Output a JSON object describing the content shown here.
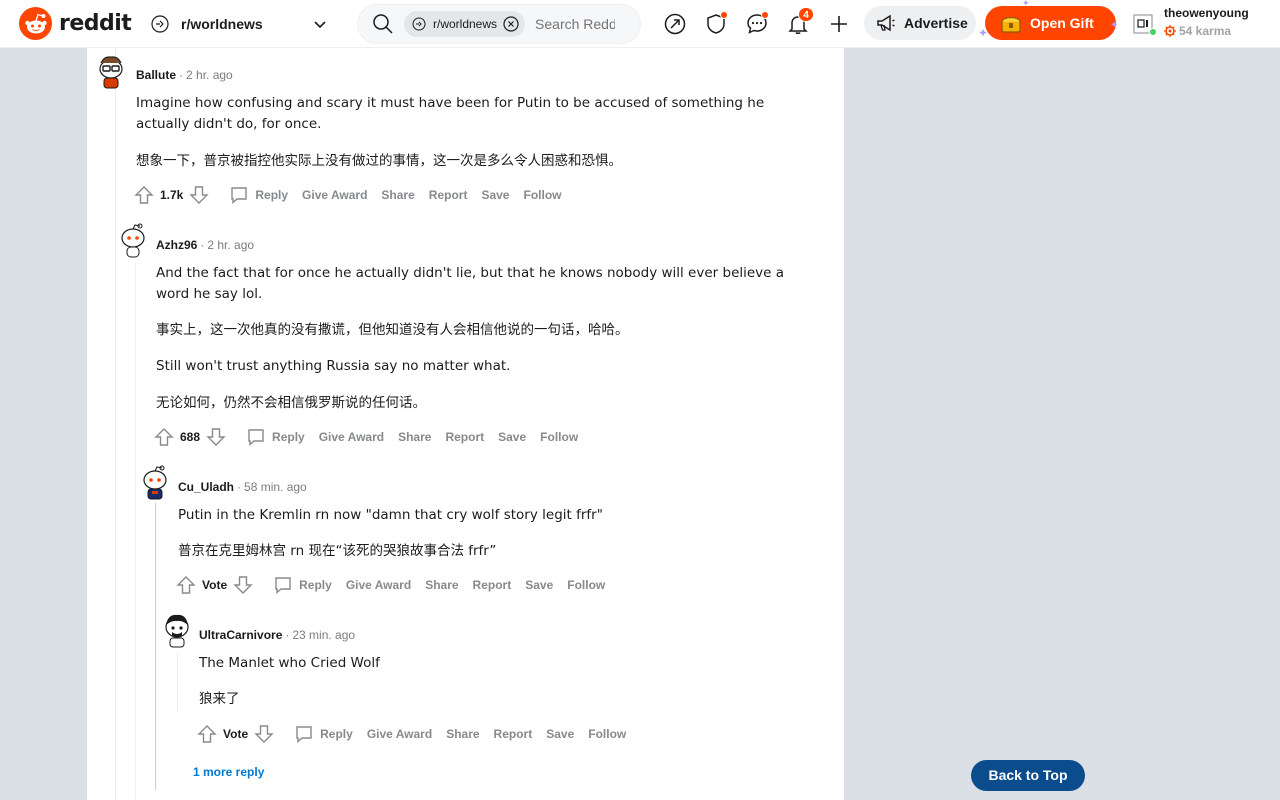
{
  "header": {
    "logo_text": "reddit",
    "community": "r/worldnews",
    "search_chip": "r/worldnews",
    "search_placeholder": "Search Reddit",
    "notification_count": "4",
    "advertise_label": "Advertise",
    "open_gift_label": "Open Gift",
    "username": "theowenyoung",
    "karma": "54 karma"
  },
  "comments": [
    {
      "author": "Ballute",
      "time": "2 hr. ago",
      "paragraphs": [
        "Imagine how confusing and scary it must have been for Putin to be accused of something he",
        "actually didn't do, for once.",
        "想象一下，普京被指控他实际上没有做过的事情，这一次是多么令人困惑和恐惧。"
      ],
      "score": "1.7k"
    },
    {
      "author": "Azhz96",
      "time": "2 hr. ago",
      "paragraphs": [
        "And the fact that for once he actually didn't lie, but that he knows nobody will ever believe a",
        "word he say lol.",
        "事实上，这一次他真的没有撒谎，但他知道没有人会相信他说的一句话，哈哈。",
        "Still won't trust anything Russia say no matter what.",
        "无论如何，仍然不会相信俄罗斯说的任何话。"
      ],
      "score": "688"
    },
    {
      "author": "Cu_Uladh",
      "time": "58 min. ago",
      "paragraphs": [
        "Putin in the Kremlin rn now \"damn that cry wolf story legit frfr\"",
        "普京在克里姆林宫 rn 现在“该死的哭狼故事合法 frfr”"
      ],
      "score": "Vote"
    },
    {
      "author": "UltraCarnivore",
      "time": "23 min. ago",
      "paragraphs": [
        "The Manlet who Cried Wolf",
        "狼来了"
      ],
      "score": "Vote"
    }
  ],
  "actions": {
    "reply": "Reply",
    "give_award": "Give Award",
    "share": "Share",
    "report": "Report",
    "save": "Save",
    "follow": "Follow"
  },
  "more_replies": "1 more reply",
  "back_to_top": "Back to Top",
  "colors": {
    "brand": "#ff4500",
    "background": "#dae0e6",
    "link": "#0079d3",
    "back_to_top": "#0a4c8c"
  }
}
